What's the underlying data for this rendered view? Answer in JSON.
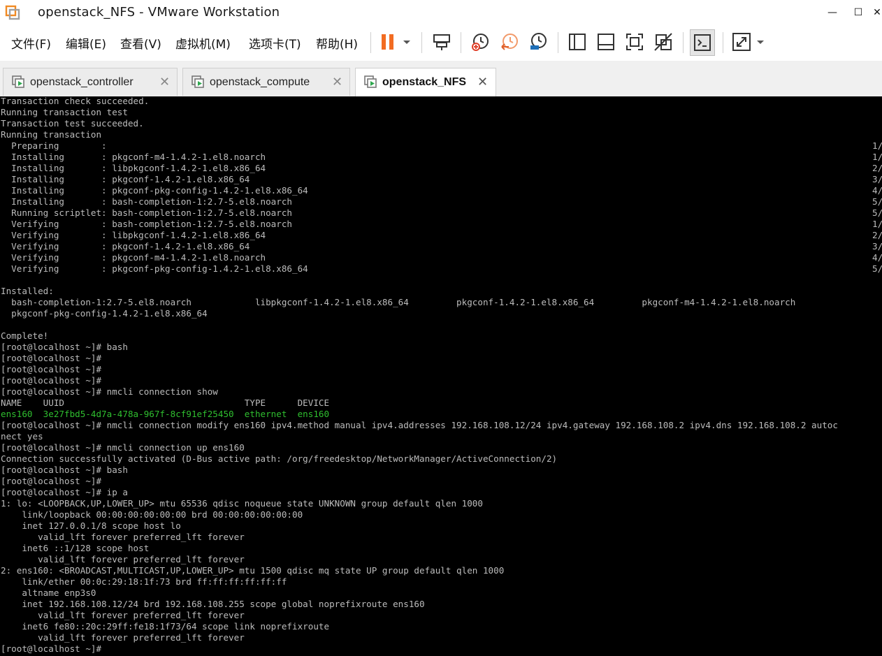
{
  "window": {
    "title": "openstack_NFS - VMware Workstation",
    "controls": {
      "minimize": "—",
      "maximize": "☐",
      "close": "✕"
    }
  },
  "menu": [
    {
      "label": "文件(F)"
    },
    {
      "label": "编辑(E)"
    },
    {
      "label": "查看(V)"
    },
    {
      "label": "虚拟机(M)"
    },
    {
      "label": "选项卡(T)"
    },
    {
      "label": "帮助(H)"
    }
  ],
  "toolbar": {
    "icons": [
      "pause-icon",
      "dropdown-arrow-icon",
      "send-keys-icon",
      "snapshot-icon",
      "revert-snapshot-icon",
      "snapshot-manager-icon",
      "library-view-icon",
      "thumbnail-view-icon",
      "fullscreen-icon",
      "unity-icon",
      "console-view-icon",
      "stretch-icon",
      "stretch-dropdown-icon"
    ],
    "colors": {
      "pause": "#f26c22",
      "accent_blue": "#1e6fb8"
    }
  },
  "tabs": [
    {
      "label": "openstack_controller",
      "active": false
    },
    {
      "label": "openstack_compute",
      "active": false
    },
    {
      "label": "openstack_NFS",
      "active": true
    }
  ],
  "terminal": {
    "lines": [
      {
        "text": "Transaction check succeeded."
      },
      {
        "text": "Running transaction test"
      },
      {
        "text": "Transaction test succeeded."
      },
      {
        "text": "Running transaction"
      },
      {
        "text": "  Preparing        :",
        "frac": "1/"
      },
      {
        "text": "  Installing       : pkgconf-m4-1.4.2-1.el8.noarch",
        "frac": "1/"
      },
      {
        "text": "  Installing       : libpkgconf-1.4.2-1.el8.x86_64",
        "frac": "2/"
      },
      {
        "text": "  Installing       : pkgconf-1.4.2-1.el8.x86_64",
        "frac": "3/"
      },
      {
        "text": "  Installing       : pkgconf-pkg-config-1.4.2-1.el8.x86_64",
        "frac": "4/"
      },
      {
        "text": "  Installing       : bash-completion-1:2.7-5.el8.noarch",
        "frac": "5/"
      },
      {
        "text": "  Running scriptlet: bash-completion-1:2.7-5.el8.noarch",
        "frac": "5/"
      },
      {
        "text": "  Verifying        : bash-completion-1:2.7-5.el8.noarch",
        "frac": "1/"
      },
      {
        "text": "  Verifying        : libpkgconf-1.4.2-1.el8.x86_64",
        "frac": "2/"
      },
      {
        "text": "  Verifying        : pkgconf-1.4.2-1.el8.x86_64",
        "frac": "3/"
      },
      {
        "text": "  Verifying        : pkgconf-m4-1.4.2-1.el8.noarch",
        "frac": "4/"
      },
      {
        "text": "  Verifying        : pkgconf-pkg-config-1.4.2-1.el8.x86_64",
        "frac": "5/"
      },
      {
        "text": ""
      },
      {
        "text": "Installed:"
      },
      {
        "text": "  bash-completion-1:2.7-5.el8.noarch            libpkgconf-1.4.2-1.el8.x86_64         pkgconf-1.4.2-1.el8.x86_64         pkgconf-m4-1.4.2-1.el8.noarch"
      },
      {
        "text": "  pkgconf-pkg-config-1.4.2-1.el8.x86_64"
      },
      {
        "text": ""
      },
      {
        "text": "Complete!"
      },
      {
        "text": "[root@localhost ~]# bash"
      },
      {
        "text": "[root@localhost ~]#"
      },
      {
        "text": "[root@localhost ~]#"
      },
      {
        "text": "[root@localhost ~]#"
      },
      {
        "text": "[root@localhost ~]# nmcli connection show"
      },
      {
        "text": "NAME    UUID                                  TYPE      DEVICE"
      },
      {
        "text": "ens160  3e27fbd5-4d7a-478a-967f-8cf91ef25450  ethernet  ens160",
        "green": true
      },
      {
        "text": "[root@localhost ~]# nmcli connection modify ens160 ipv4.method manual ipv4.addresses 192.168.108.12/24 ipv4.gateway 192.168.108.2 ipv4.dns 192.168.108.2 autoc"
      },
      {
        "text": "nect yes"
      },
      {
        "text": "[root@localhost ~]# nmcli connection up ens160"
      },
      {
        "text": "Connection successfully activated (D-Bus active path: /org/freedesktop/NetworkManager/ActiveConnection/2)"
      },
      {
        "text": "[root@localhost ~]# bash"
      },
      {
        "text": "[root@localhost ~]#"
      },
      {
        "text": "[root@localhost ~]# ip a"
      },
      {
        "text": "1: lo: <LOOPBACK,UP,LOWER_UP> mtu 65536 qdisc noqueue state UNKNOWN group default qlen 1000"
      },
      {
        "text": "    link/loopback 00:00:00:00:00:00 brd 00:00:00:00:00:00"
      },
      {
        "text": "    inet 127.0.0.1/8 scope host lo"
      },
      {
        "text": "       valid_lft forever preferred_lft forever"
      },
      {
        "text": "    inet6 ::1/128 scope host"
      },
      {
        "text": "       valid_lft forever preferred_lft forever"
      },
      {
        "text": "2: ens160: <BROADCAST,MULTICAST,UP,LOWER_UP> mtu 1500 qdisc mq state UP group default qlen 1000"
      },
      {
        "text": "    link/ether 00:0c:29:18:1f:73 brd ff:ff:ff:ff:ff:ff"
      },
      {
        "text": "    altname enp3s0"
      },
      {
        "text": "    inet 192.168.108.12/24 brd 192.168.108.255 scope global noprefixroute ens160"
      },
      {
        "text": "       valid_lft forever preferred_lft forever"
      },
      {
        "text": "    inet6 fe80::20c:29ff:fe18:1f73/64 scope link noprefixroute"
      },
      {
        "text": "       valid_lft forever preferred_lft forever"
      },
      {
        "text": "[root@localhost ~]#"
      }
    ]
  }
}
